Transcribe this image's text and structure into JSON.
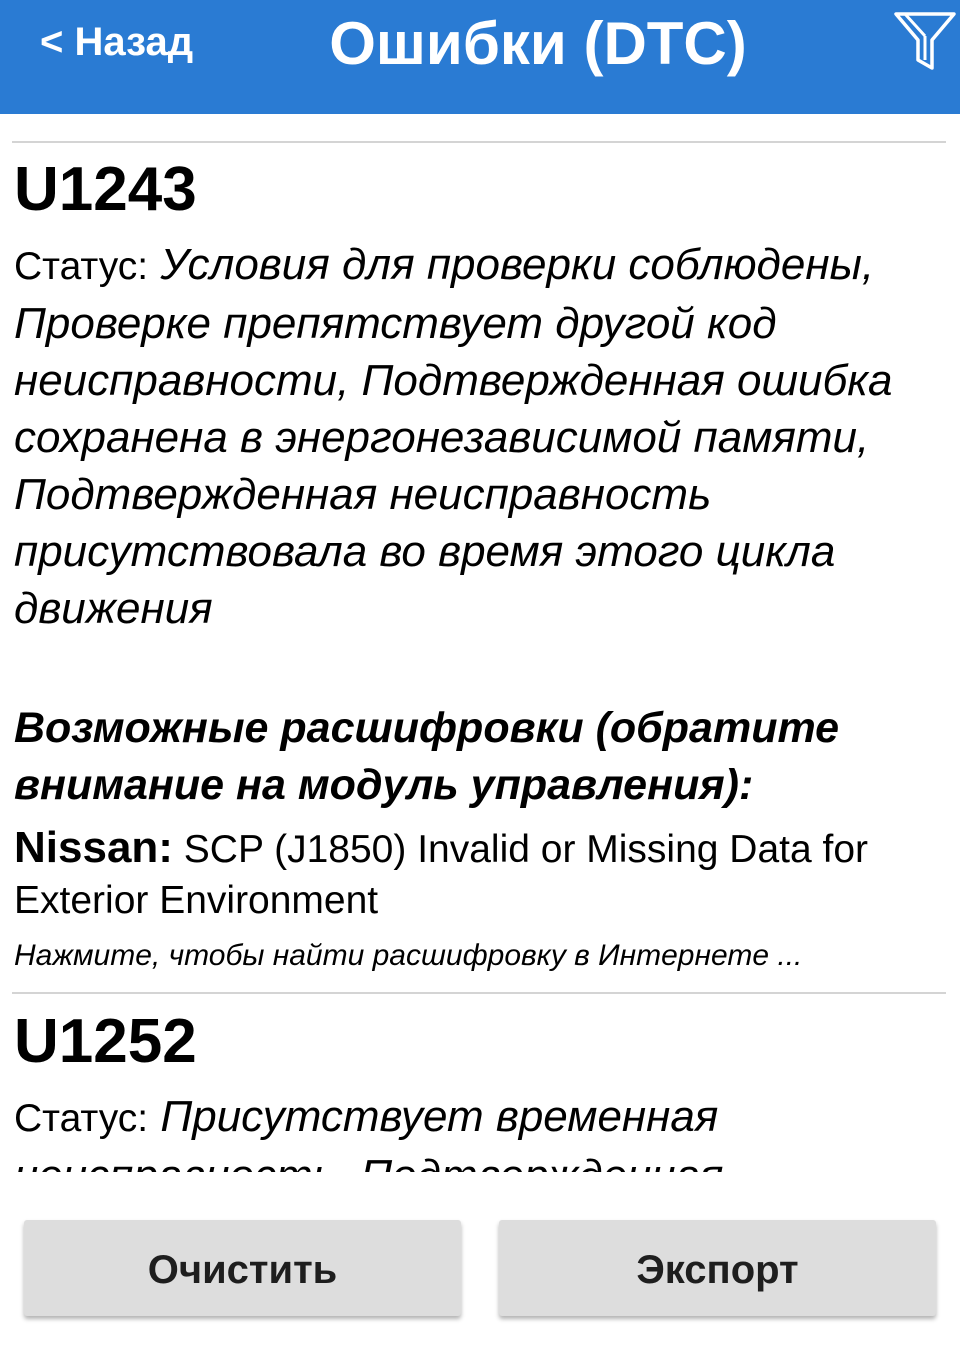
{
  "header": {
    "back_label": "< Назад",
    "title": "Ошибки (DTC)",
    "filter_icon": "filter-funnel-icon",
    "background_color": "#2a7bd3"
  },
  "dtc_list": [
    {
      "code": "U1243",
      "status_label": "Статус:",
      "status_value": "Условия для проверки соблюдены, Проверке препятствует другой код неисправности, Подтвержденная ошибка сохранена в энергонезависимой памяти, Подтвержденная неисправность присутствовала во время этого цикла движения",
      "decode_heading": "Возможные расшифровки (обратите внимание на модуль управления):",
      "decode_make": "Nissan:",
      "decode_text": "SCP (J1850) Invalid or Missing Data for Exterior Environment",
      "search_link": "Нажмите, чтобы найти расшифровку в Интернете ..."
    },
    {
      "code": "U1252",
      "status_label": "Статус:",
      "status_value": "Присутствует временная неисправность, Подтвержденная"
    }
  ],
  "actions": {
    "clear_label": "Очистить",
    "export_label": "Экспорт"
  }
}
